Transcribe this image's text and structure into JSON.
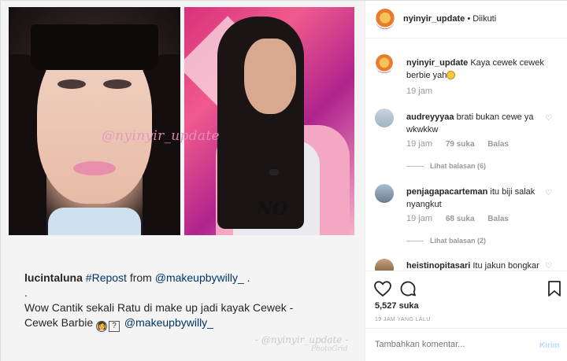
{
  "header": {
    "username": "nyinyir_update",
    "separator": "•",
    "follow_status": "Diikuti"
  },
  "media": {
    "watermark": "@nyinyir_update",
    "shirt_print": "NO",
    "bottom_watermark": "- @nyinyir_update -",
    "bottom_watermark_sub": "PhotoGrid"
  },
  "caption": {
    "user": "lucintaluna",
    "repost": "#Repost",
    "from": " from ",
    "mention": "@makeupbywilly_",
    "mention_end": " .",
    "dot": ".",
    "line1": "Wow Cantik sekali Ratu di make up jadi kayak Cewek -",
    "line2": "Cewek Barbie ",
    "emoji1": "👩",
    "emoji2": "?",
    "mention2": " @makeupbywilly_"
  },
  "comments": [
    {
      "user": "nyinyir_update",
      "text": "Kaya cewek cewek berbie yah",
      "time": "19 jam"
    },
    {
      "user": "audreyyyaa",
      "text": "brati bukan cewe ya wkwkkw",
      "time": "19 jam",
      "likes": "79 suka",
      "reply": "Balas",
      "view_replies": "Lihat balasan (6)"
    },
    {
      "user": "penjagapacarteman",
      "text": "itu biji salak nyangkut",
      "time": "19 jam",
      "likes": "68 suka",
      "reply": "Balas",
      "view_replies": "Lihat balasan (2)"
    },
    {
      "user": "heistinopitasari",
      "text": "Itu jakun bongkar"
    }
  ],
  "actions": {
    "like_icon": "heart-icon",
    "comment_icon": "comment-icon",
    "save_icon": "bookmark-icon",
    "likes_count": "5,527 suka",
    "time_ago": "19 JAM YANG LALU"
  },
  "comment_box": {
    "placeholder": "Tambahkan komentar...",
    "post_label": "Kirim"
  },
  "colors": {
    "link": "#003569",
    "muted": "#999999",
    "post_disabled": "#b3dbff"
  }
}
